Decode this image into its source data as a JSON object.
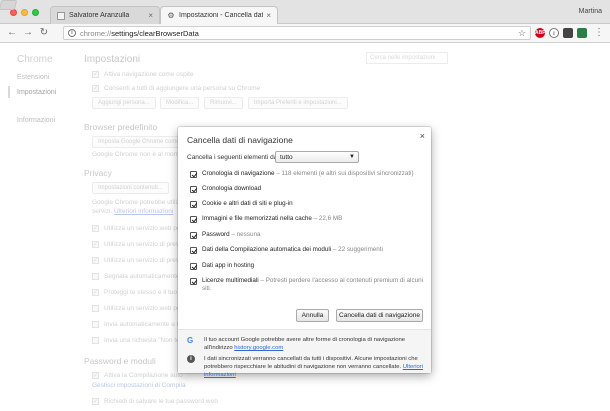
{
  "window": {
    "profile_name": "Martina",
    "tabs": [
      {
        "label": "Salvatore Aranzulla",
        "close": "×"
      },
      {
        "label": "Impostazioni - Cancella dati di",
        "close": "×"
      }
    ]
  },
  "toolbar": {
    "back": "←",
    "forward": "→",
    "reload": "↻",
    "url_scheme": "chrome://",
    "url_path": "settings/clearBrowserData",
    "star": "☆",
    "extensions": [
      "ABP",
      "i",
      "",
      ""
    ],
    "menu": "⋮"
  },
  "settings_page": {
    "brand": "Chrome",
    "title": "Impostazioni",
    "search_placeholder": "Cerca nelle impostazioni",
    "sidebar": [
      {
        "label": "Estensioni"
      },
      {
        "label": "Impostazioni"
      },
      {
        "label": "Informazioni"
      }
    ],
    "lines": {
      "guest": "Attiva navigazione come ospite",
      "add_person": "Consenti a tutti di aggiungere una persona su Chrome",
      "default_browser_head": "Browser predefinito",
      "default_btn": "Imposta Google Chrome come",
      "default_note": "Google Chrome non è al mome",
      "privacy_head": "Privacy",
      "content_btn": "Impostazioni contenuti...",
      "privacy_note": "Google Chrome potrebbe utiliz",
      "privacy_note2": "servizi.",
      "privacy_link": "Ulteriori informazioni",
      "c1": "Utilizza un servizio web per",
      "c2": "Utilizza un servizio di previsioni per",
      "c3": "Utilizza un servizio di previs",
      "c4": "Segnala automaticamente a",
      "c5": "Proteggi te stesso e il tuo d",
      "c6": "Utilizza un servizio web per",
      "c7": "Invia automaticamente a Goo",
      "c8": "Invia una richiesta \"Non tenere",
      "passwords_head": "Password e moduli",
      "autofill": "Attiva la Compilazione auto",
      "autofill_link": "Gestisci impostazioni di Compila",
      "save_pw": "Richiedi di salvare le tue password web"
    },
    "buttons": {
      "add_person": "Aggiungi persona...",
      "edit": "Modifica...",
      "remove": "Rimuovi...",
      "import": "Importa Preferiti e impostazioni..."
    }
  },
  "dialog": {
    "title": "Cancella dati di navigazione",
    "close": "×",
    "period_label": "Cancella i seguenti elementi da:",
    "period_value": "tutto",
    "options": [
      {
        "label": "Cronologia di navigazione",
        "desc": "– 118 elementi (e altri sui dispositivi sincronizzati)"
      },
      {
        "label": "Cronologia download",
        "desc": ""
      },
      {
        "label": "Cookie e altri dati di siti e plug-in",
        "desc": ""
      },
      {
        "label": "Immagini e file memorizzati nella cache",
        "desc": "– 22,6 MB"
      },
      {
        "label": "Password",
        "desc": "– nessuna"
      },
      {
        "label": "Dati della Compilazione automatica dei moduli",
        "desc": "– 22 suggerimenti"
      },
      {
        "label": "Dati app in hosting",
        "desc": ""
      },
      {
        "label": "Licenze multimediali",
        "desc": "– Potresti perdere l'accesso ai contenuti premium di alcuni siti."
      }
    ],
    "cancel_label": "Annulla",
    "confirm_label": "Cancella dati di navigazione",
    "footer": {
      "google_text": "Il tuo account Google potrebbe avere altre forme di cronologia di navigazione all'indirizzo",
      "google_link": "history.google.com",
      "sync_text": "I dati sincronizzati verranno cancellati da tutti i dispositivi. Alcune impostazioni che potrebbero rispecchiare le abitudini di navigazione non verranno cancellate.",
      "sync_link": "Ulteriori informazioni"
    }
  }
}
